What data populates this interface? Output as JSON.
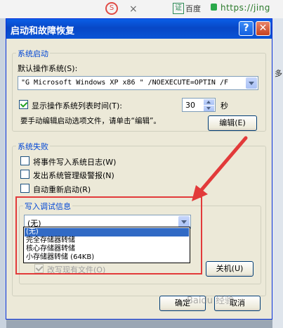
{
  "browser": {
    "tab_close": "×",
    "badge": "证",
    "baidu": "百度",
    "url": "https://jing"
  },
  "background": {
    "right_text": "多"
  },
  "dialog": {
    "title": "启动和故障恢复",
    "help_glyph": "?",
    "close_glyph": "✕",
    "startup": {
      "group_label": "系统启动",
      "default_os_label": "默认操作系统(S):",
      "default_os_value": "\"G Microsoft Windows XP x86     \" /NOEXECUTE=OPTIN /F",
      "show_list_label": "显示操作系统列表时间(T):",
      "show_list_checked": true,
      "list_time_value": "30",
      "seconds_label": "秒",
      "edit_hint": "要手动编辑启动选项文件，请单击“编辑”。",
      "edit_button": "编辑(E)"
    },
    "failure": {
      "group_label": "系统失败",
      "write_event_label": "将事件写入系统日志(W)",
      "send_alert_label": "发出系统管理级警报(N)",
      "auto_restart_label": "自动重新启动(R)"
    },
    "debug": {
      "group_label": "写入调试信息",
      "selected_value": "(无)",
      "options": [
        "(无)",
        "完全存储器转储",
        "核心存储器转储",
        "小存储器转储 (64KB)"
      ],
      "overwrite_label": "改写现有文件(O)",
      "shutdown_button": "关机(U)"
    },
    "ok_button": "确定",
    "cancel_button": "取消"
  },
  "watermark": "Baidu 经验"
}
